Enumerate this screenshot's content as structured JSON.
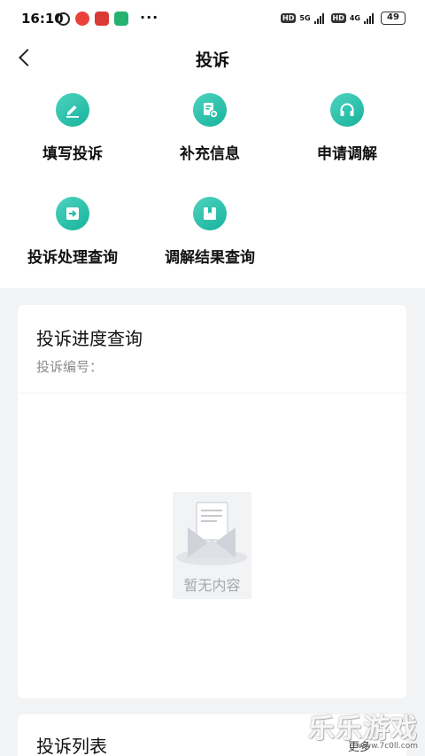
{
  "status_bar": {
    "time": "16:10",
    "dots": "···",
    "hd1": "HD",
    "net1": "5G",
    "hd2": "HD",
    "net2": "4G",
    "battery": "49"
  },
  "nav": {
    "title": "投诉"
  },
  "menu": [
    {
      "label": "填写投诉",
      "icon": "edit-icon"
    },
    {
      "label": "补充信息",
      "icon": "add-document-icon"
    },
    {
      "label": "申请调解",
      "icon": "headset-icon"
    },
    {
      "label": "投诉处理查询",
      "icon": "enter-icon"
    },
    {
      "label": "调解结果查询",
      "icon": "book-icon"
    }
  ],
  "progress": {
    "title": "投诉进度查询",
    "number_label": "投诉编号：",
    "empty_text": "暂无内容"
  },
  "list": {
    "title": "投诉列表",
    "more": "更多"
  },
  "watermark": {
    "main": "乐乐游戏",
    "sub": "www.7c0ll.com"
  },
  "colors": {
    "accent": "#1fbfa5",
    "page_bg": "#f2f3f5"
  }
}
